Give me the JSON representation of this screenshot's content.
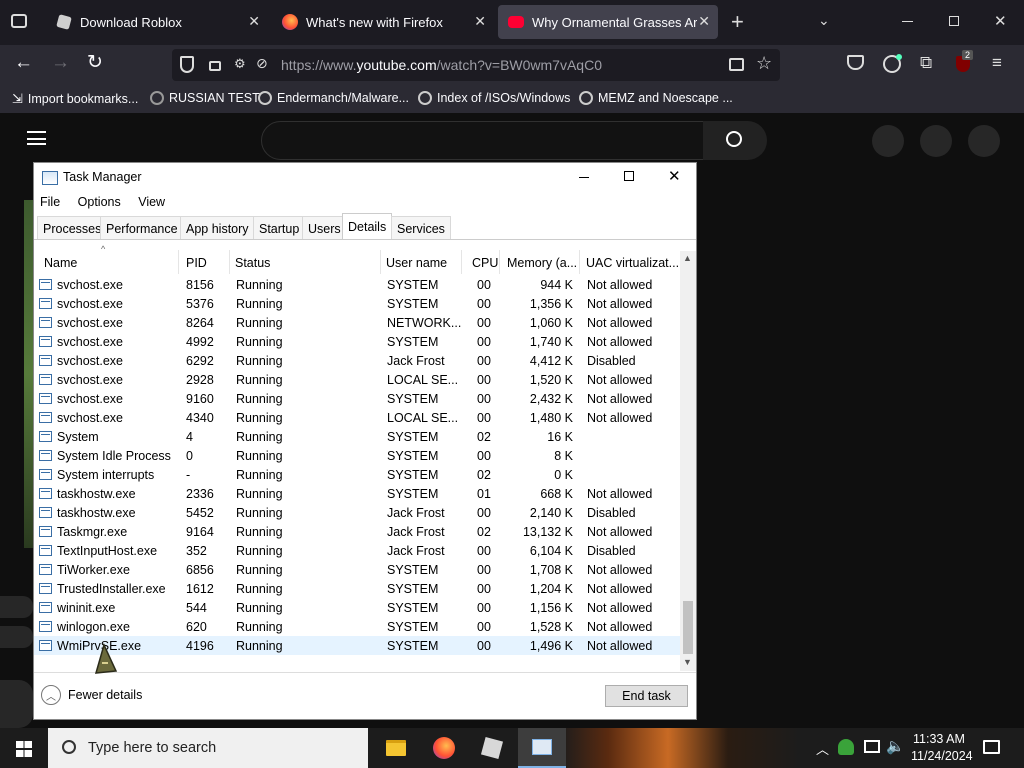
{
  "browser": {
    "tabs": [
      {
        "label": "Download Roblox",
        "icon": "roblox-icon",
        "active": false
      },
      {
        "label": "What's new with Firefox",
        "icon": "firefox-icon",
        "active": false
      },
      {
        "label": "Why Ornamental Grasses Are th",
        "icon": "youtube-icon",
        "active": true
      }
    ],
    "url": "https://www.youtube.com/watch?v=BW0wm7vAqC0",
    "url_display_host": "https://www.",
    "url_display_domain": "youtube.com",
    "url_display_path": "/watch?v=BW0wm7vAqC0",
    "extension_badge": "2",
    "bookmarks": [
      {
        "label": "Import bookmarks...",
        "icon": "import-icon"
      },
      {
        "label": "RUSSIAN TEST",
        "icon": "mask-icon"
      },
      {
        "label": "Endermanch/Malware...",
        "icon": "google-icon"
      },
      {
        "label": "Index of /ISOs/Windows",
        "icon": "google-icon"
      },
      {
        "label": "MEMZ and Noescape ...",
        "icon": "globe-icon"
      }
    ]
  },
  "task_manager": {
    "title": "Task Manager",
    "menu": [
      "File",
      "Options",
      "View"
    ],
    "tabs": [
      "Processes",
      "Performance",
      "App history",
      "Startup",
      "Users",
      "Details",
      "Services"
    ],
    "selected_tab": "Details",
    "columns": [
      "Name",
      "PID",
      "Status",
      "User name",
      "CPU",
      "Memory (a...",
      "UAC virtualizat..."
    ],
    "rows": [
      {
        "name": "svchost.exe",
        "pid": "8156",
        "status": "Running",
        "user": "SYSTEM",
        "cpu": "00",
        "mem": "944 K",
        "uac": "Not allowed"
      },
      {
        "name": "svchost.exe",
        "pid": "5376",
        "status": "Running",
        "user": "SYSTEM",
        "cpu": "00",
        "mem": "1,356 K",
        "uac": "Not allowed"
      },
      {
        "name": "svchost.exe",
        "pid": "8264",
        "status": "Running",
        "user": "NETWORK...",
        "cpu": "00",
        "mem": "1,060 K",
        "uac": "Not allowed"
      },
      {
        "name": "svchost.exe",
        "pid": "4992",
        "status": "Running",
        "user": "SYSTEM",
        "cpu": "00",
        "mem": "1,740 K",
        "uac": "Not allowed"
      },
      {
        "name": "svchost.exe",
        "pid": "6292",
        "status": "Running",
        "user": "Jack Frost",
        "cpu": "00",
        "mem": "4,412 K",
        "uac": "Disabled"
      },
      {
        "name": "svchost.exe",
        "pid": "2928",
        "status": "Running",
        "user": "LOCAL SE...",
        "cpu": "00",
        "mem": "1,520 K",
        "uac": "Not allowed"
      },
      {
        "name": "svchost.exe",
        "pid": "9160",
        "status": "Running",
        "user": "SYSTEM",
        "cpu": "00",
        "mem": "2,432 K",
        "uac": "Not allowed"
      },
      {
        "name": "svchost.exe",
        "pid": "4340",
        "status": "Running",
        "user": "LOCAL SE...",
        "cpu": "00",
        "mem": "1,480 K",
        "uac": "Not allowed"
      },
      {
        "name": "System",
        "pid": "4",
        "status": "Running",
        "user": "SYSTEM",
        "cpu": "02",
        "mem": "16 K",
        "uac": ""
      },
      {
        "name": "System Idle Process",
        "pid": "0",
        "status": "Running",
        "user": "SYSTEM",
        "cpu": "00",
        "mem": "8 K",
        "uac": ""
      },
      {
        "name": "System interrupts",
        "pid": "-",
        "status": "Running",
        "user": "SYSTEM",
        "cpu": "02",
        "mem": "0 K",
        "uac": ""
      },
      {
        "name": "taskhostw.exe",
        "pid": "2336",
        "status": "Running",
        "user": "SYSTEM",
        "cpu": "01",
        "mem": "668 K",
        "uac": "Not allowed"
      },
      {
        "name": "taskhostw.exe",
        "pid": "5452",
        "status": "Running",
        "user": "Jack Frost",
        "cpu": "00",
        "mem": "2,140 K",
        "uac": "Disabled"
      },
      {
        "name": "Taskmgr.exe",
        "pid": "9164",
        "status": "Running",
        "user": "Jack Frost",
        "cpu": "02",
        "mem": "13,132 K",
        "uac": "Not allowed"
      },
      {
        "name": "TextInputHost.exe",
        "pid": "352",
        "status": "Running",
        "user": "Jack Frost",
        "cpu": "00",
        "mem": "6,104 K",
        "uac": "Disabled"
      },
      {
        "name": "TiWorker.exe",
        "pid": "6856",
        "status": "Running",
        "user": "SYSTEM",
        "cpu": "00",
        "mem": "1,708 K",
        "uac": "Not allowed"
      },
      {
        "name": "TrustedInstaller.exe",
        "pid": "1612",
        "status": "Running",
        "user": "SYSTEM",
        "cpu": "00",
        "mem": "1,204 K",
        "uac": "Not allowed"
      },
      {
        "name": "wininit.exe",
        "pid": "544",
        "status": "Running",
        "user": "SYSTEM",
        "cpu": "00",
        "mem": "1,156 K",
        "uac": "Not allowed"
      },
      {
        "name": "winlogon.exe",
        "pid": "620",
        "status": "Running",
        "user": "SYSTEM",
        "cpu": "00",
        "mem": "1,528 K",
        "uac": "Not allowed"
      },
      {
        "name": "WmiPrvSE.exe",
        "pid": "4196",
        "status": "Running",
        "user": "SYSTEM",
        "cpu": "00",
        "mem": "1,496 K",
        "uac": "Not allowed"
      }
    ],
    "highlighted_row": 19,
    "fewer_details": "Fewer details",
    "end_task": "End task"
  },
  "taskbar": {
    "search_placeholder": "Type here to search",
    "time": "11:33 AM",
    "date": "11/24/2024",
    "apps": [
      "file-explorer-icon",
      "firefox-icon",
      "roblox-icon",
      "task-manager-icon"
    ]
  },
  "colors": {
    "browser_bg": "#1c1b22",
    "toolbar_bg": "#2b2a33",
    "active_tab_bg": "#42414d",
    "youtube_bg": "#0f0f0f",
    "selection_bg": "#e5f3ff",
    "taskbar_bg": "#1c1c1c"
  }
}
